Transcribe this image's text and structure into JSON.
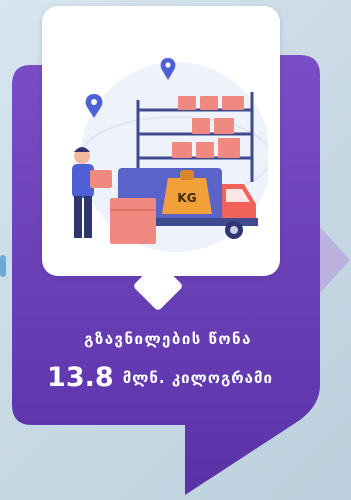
{
  "panel": {
    "label": "გზავნილების წონა",
    "value": "13.8",
    "unit": "მლნ. კილოგრამი"
  },
  "illustration": {
    "crate_label": "KG"
  },
  "colors": {
    "panel_purple": "#6a3fb8",
    "panel_purple_dark": "#4e2a9a",
    "crate_orange": "#f2a03a",
    "truck_blue": "#5a63c9",
    "truck_red": "#f0625a",
    "box_salmon": "#f08a80",
    "pin_blue": "#4f5fd8"
  }
}
